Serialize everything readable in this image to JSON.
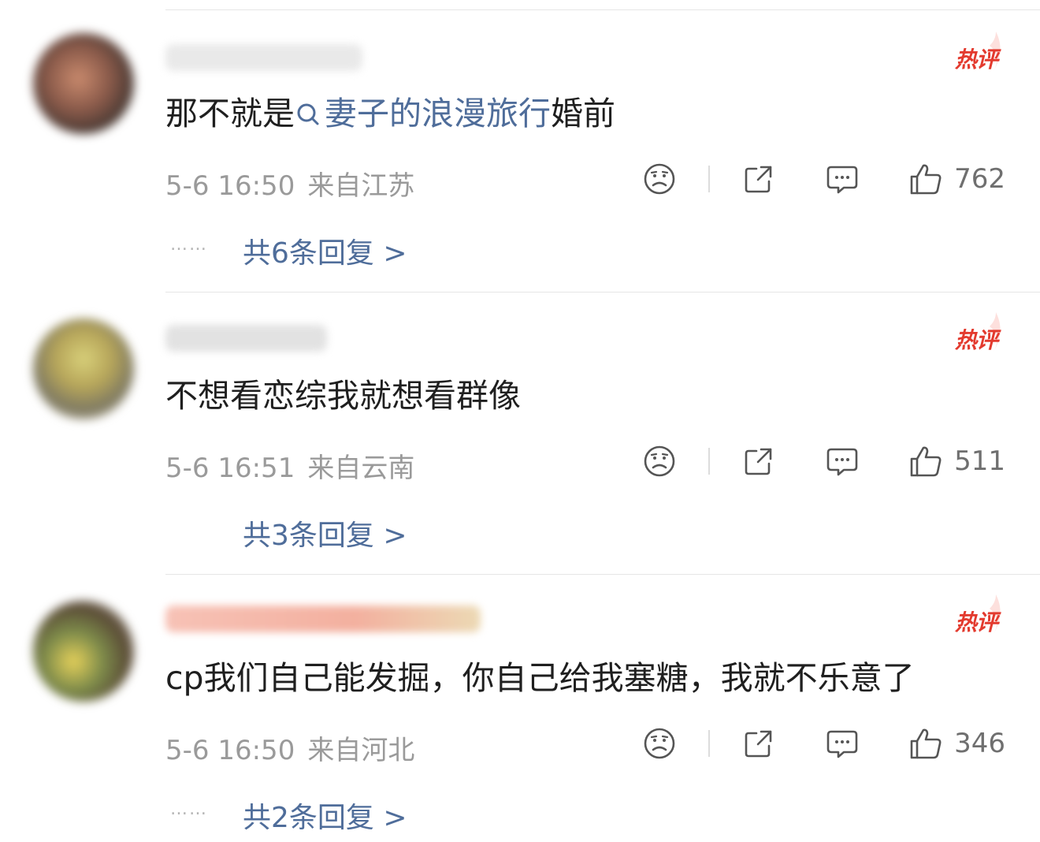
{
  "hot_label": "热评",
  "comments": [
    {
      "content_prefix": "那不就是",
      "topic_link": "妻子的浪漫旅行",
      "content_suffix": "婚前",
      "date": "5-6 16:50",
      "location": "来自江苏",
      "likes": "762",
      "replies": "共6条回复 >",
      "dots": "……"
    },
    {
      "content_prefix": "不想看恋综我就想看群像",
      "date": "5-6 16:51",
      "location": "来自云南",
      "likes": "511",
      "replies": "共3条回复 >"
    },
    {
      "content_prefix": "cp我们自己能发掘，你自己给我塞糖，我就不乐意了",
      "date": "5-6 16:50",
      "location": "来自河北",
      "likes": "346",
      "replies": "共2条回复 >",
      "dots": "……"
    }
  ],
  "icons": {
    "dislike": "sad-face-icon",
    "share": "share-icon",
    "comment": "comment-icon",
    "like": "thumbs-up-icon",
    "search": "search-icon",
    "hot_flame": "flame-icon"
  },
  "colors": {
    "hot": "#e33a2e",
    "link": "#4f6d9a",
    "meta": "#9a9a9a"
  }
}
